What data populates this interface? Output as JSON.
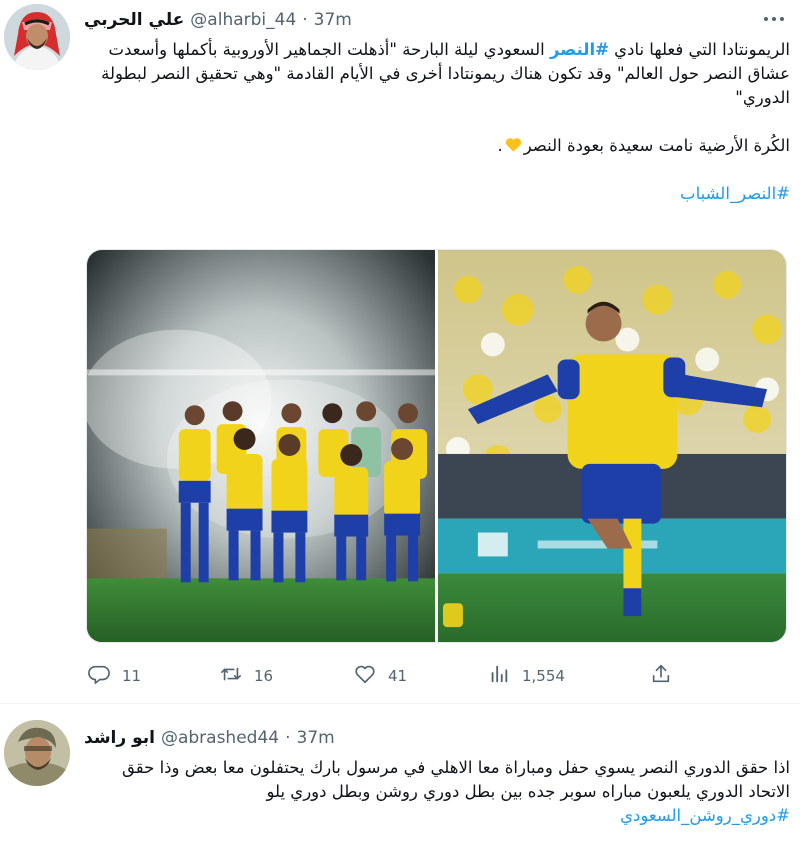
{
  "tweets": [
    {
      "display_name": "علي الحربي",
      "handle": "@alharbi_44",
      "separator": "·",
      "time": "37m",
      "text_before_tag": "الريمونتادا التي فعلها نادي ",
      "hashtag_inline": "#النصر",
      "text_after_tag": " السعودي ليلة البارحة \"أذهلت الجماهير الأوروبية بأكملها وأسعدت عشاق النصر حول العالم\" وقد تكون هناك ريمونتادا أخرى في الأيام القادمة \"وهي تحقيق النصر لبطولة الدوري\"",
      "line2": "الكُرة الأرضية نامت سعيدة بعودة النصر",
      "line2_end": ".",
      "hashtag_footer": "#النصر_الشباب",
      "media": [
        {
          "alt": "team-photo"
        },
        {
          "alt": "celebration-photo"
        }
      ],
      "actions": {
        "reply_count": "11",
        "retweet_count": "16",
        "like_count": "41",
        "views_count": "1,554"
      },
      "icons": {
        "reply": "reply-icon",
        "retweet": "retweet-icon",
        "like": "heart-icon",
        "views": "views-icon",
        "share": "share-icon",
        "more": "more-icon"
      }
    },
    {
      "display_name": "ابو راشد",
      "handle": "@abrashed44",
      "separator": "·",
      "time": "37m",
      "text": "اذا حقق الدوري النصر يسوي حفل ومباراة معا الاهلي في مرسول بارك يحتفلون معا بعض وذا حقق الاتحاد الدوري يلعبون مباراه سوبر جده بين بطل دوري روشن وبطل دوري يلو",
      "hashtag": "#دوري_روشن_السعودي"
    }
  ],
  "colors": {
    "link": "#1d9bf0",
    "text": "#0f1419",
    "secondary": "#536471",
    "nassr_yellow": "#f2d31b",
    "nassr_blue": "#1e3fa8"
  }
}
